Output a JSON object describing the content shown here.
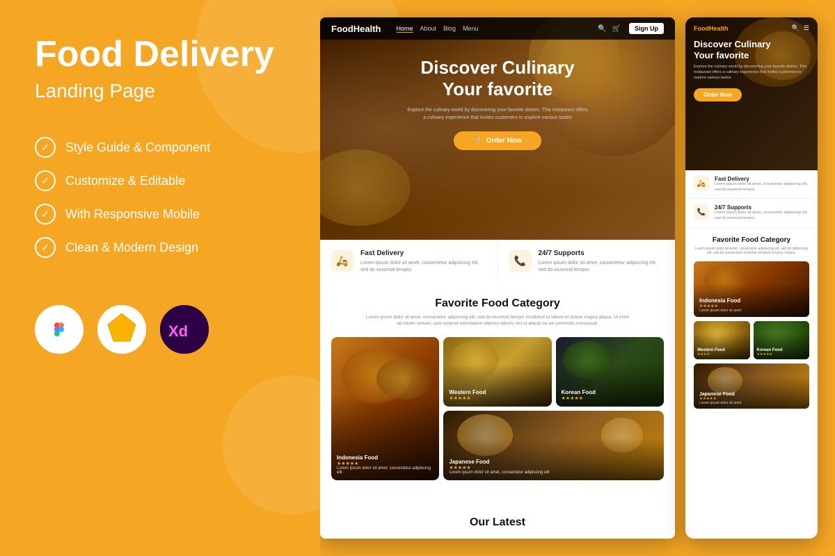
{
  "left": {
    "title_line1": "Food Delivery",
    "subtitle": "Landing Page",
    "features": [
      "Style Guide & Component",
      "Customize & Editable",
      "With Responsive Mobile",
      "Clean & Modern Design"
    ],
    "tools": [
      {
        "name": "Figma",
        "letter": "F"
      },
      {
        "name": "Sketch",
        "letter": "S"
      },
      {
        "name": "XD",
        "letter": "XD"
      }
    ]
  },
  "desktop": {
    "nav": {
      "logo": "FoodHealth",
      "links": [
        "Home",
        "About",
        "Blog",
        "Menu"
      ],
      "signup": "Sign Up"
    },
    "hero": {
      "title_line1": "Discover Culinary",
      "title_line2": "Your favorite",
      "desc": "Explore the culinary world by discovering your favorite dishes. This restaurant offers a culinary experience that invites customers to explore various tastes",
      "order_btn": "Order Now"
    },
    "features": [
      {
        "icon": "🛵",
        "title": "Fast Delivery",
        "desc": "Lorem ipsum dolor sit amet, consectetur adipiscing elit, sed do eiusmod tempor."
      },
      {
        "icon": "📞",
        "title": "24/7 Supports",
        "desc": "Lorem ipsum dolor sit amet, consectetur adipiscing elit, sed do eiusmod tempor."
      }
    ],
    "category": {
      "title": "Favorite Food Category",
      "desc": "Lorem ipsum dolor sit amet, consectetur adipiscing elit, sed do eiusmod tempor incididunt ut labore et dolore magna aliqua. Ut enim ad minim veniam, quis nostrud exercitation ullamco laboris nisi ut aliquip ex ea commodo consequat.",
      "foods": [
        {
          "name": "Indonesia Food",
          "stars": "★★★★★",
          "size": "large"
        },
        {
          "name": "Western Food",
          "stars": "★★★★★"
        },
        {
          "name": "Korean Food",
          "stars": "★★★★★"
        },
        {
          "name": "Japanese Food",
          "stars": "★★★★★",
          "size": "large"
        }
      ]
    },
    "our_latest": "Our Latest"
  },
  "mobile": {
    "nav": {
      "logo": "FoodHealth"
    },
    "hero": {
      "title_line1": "Discover Culinary",
      "title_line2": "Your favorite",
      "desc": "Explore the culinary world by discovering your favorite dishes. This restaurant offers a culinary experience that invites customers to explore various tastes",
      "order_btn": "Order Now"
    },
    "features": [
      {
        "icon": "🛵",
        "title": "Fast Delivery",
        "desc": "Lorem ipsum dolor sit amet, consectetur adipiscing elit, sed do eiusmod tempor."
      },
      {
        "icon": "📞",
        "title": "24/7 Supports",
        "desc": "Lorem ipsum dolor sit amet, consectetur adipiscing elit, sed do eiusmod tempor."
      }
    ],
    "category": {
      "title": "Favorite Food Category",
      "desc": "Lorem ipsum dolor sit amet, consectetur adipiscing elit, sed do adipiscing elit, sed do consectetur molestie tincidunt id lacus magna.",
      "foods": [
        {
          "name": "Indonesia Food",
          "stars": "★★★★★",
          "desc": "Lorem ipsum dolor sit amet"
        },
        {
          "name": "Western Food",
          "stars": "★★★★"
        },
        {
          "name": "Korean Food",
          "stars": "★★★★★"
        },
        {
          "name": "Japanese Food",
          "stars": "★★★★★",
          "desc": "Lorem ipsum dolor sit amet"
        }
      ]
    }
  },
  "colors": {
    "primary": "#F5A623",
    "dark": "#1a1a1a",
    "white": "#ffffff"
  }
}
